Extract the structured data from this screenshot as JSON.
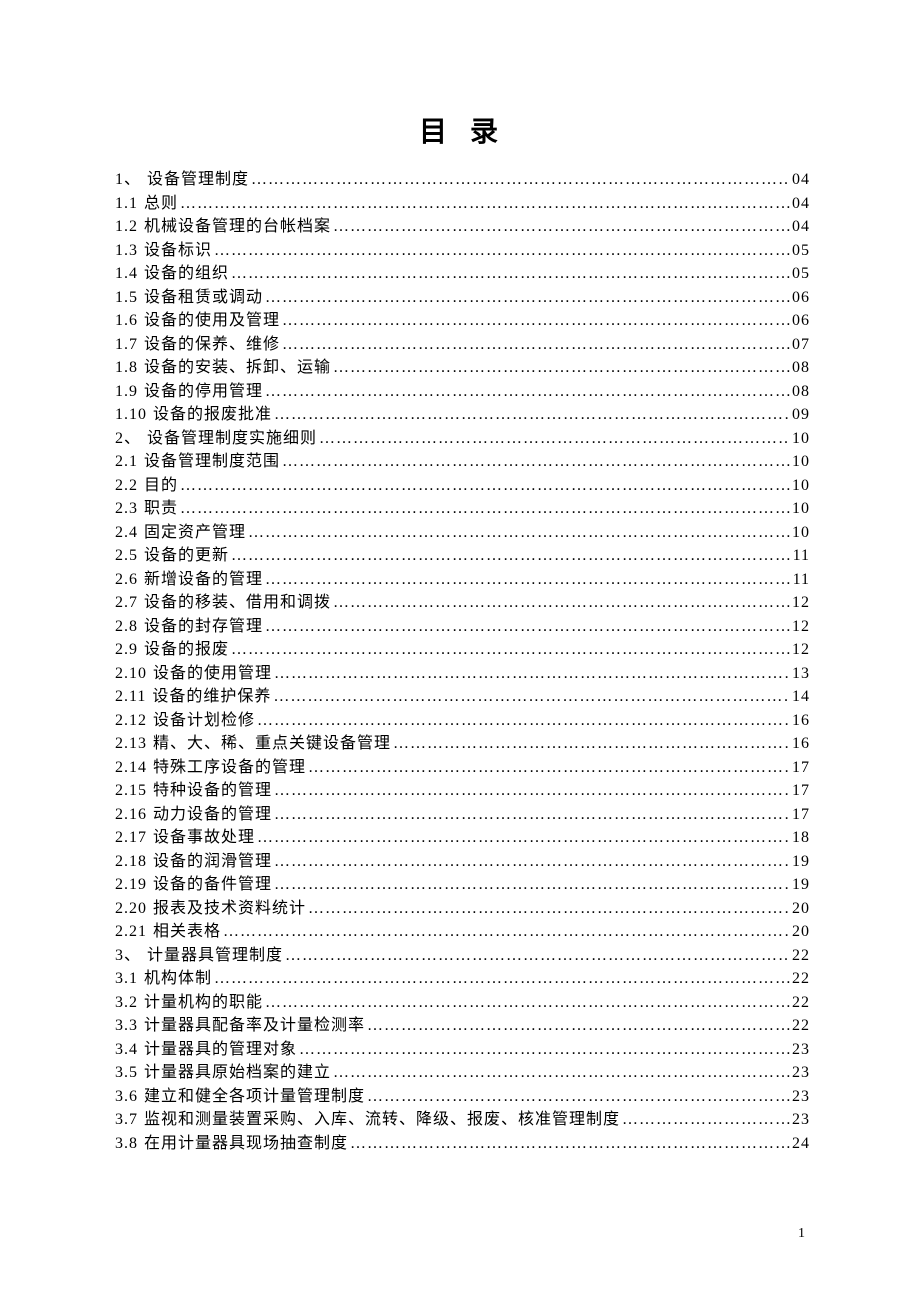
{
  "title": "目 录",
  "page_number": "1",
  "entries": [
    {
      "num": "1、",
      "label": "设备管理制度",
      "page": "04"
    },
    {
      "num": "1.1",
      "label": "总则",
      "page": "04"
    },
    {
      "num": "1.2",
      "label": "机械设备管理的台帐档案",
      "page": "04"
    },
    {
      "num": "1.3",
      "label": "设备标识",
      "page": "05"
    },
    {
      "num": "1.4",
      "label": "设备的组织",
      "page": "05"
    },
    {
      "num": "1.5",
      "label": "设备租赁或调动",
      "page": "06"
    },
    {
      "num": "1.6",
      "label": "设备的使用及管理",
      "page": "06"
    },
    {
      "num": "1.7",
      "label": "设备的保养、维修",
      "page": "07"
    },
    {
      "num": "1.8",
      "label": "设备的安装、拆卸、运输",
      "page": "08"
    },
    {
      "num": "1.9",
      "label": "设备的停用管理",
      "page": "08"
    },
    {
      "num": "1.10",
      "label": "设备的报废批准",
      "page": "09"
    },
    {
      "num": "2、",
      "label": "设备管理制度实施细则",
      "page": "10"
    },
    {
      "num": "2.1",
      "label": "设备管理制度范围",
      "page": "10"
    },
    {
      "num": "2.2",
      "label": "目的",
      "page": "10"
    },
    {
      "num": "2.3",
      "label": "职责",
      "page": "10"
    },
    {
      "num": "2.4",
      "label": "固定资产管理",
      "page": "10"
    },
    {
      "num": "2.5",
      "label": "设备的更新",
      "page": "11"
    },
    {
      "num": "2.6",
      "label": "新增设备的管理",
      "page": "11"
    },
    {
      "num": "2.7",
      "label": "设备的移装、借用和调拨",
      "page": "12"
    },
    {
      "num": "2.8",
      "label": "设备的封存管理",
      "page": "12"
    },
    {
      "num": "2.9",
      "label": "设备的报废",
      "page": "12"
    },
    {
      "num": "2.10",
      "label": "设备的使用管理",
      "page": "13"
    },
    {
      "num": "2.11",
      "label": "设备的维护保养",
      "page": "14"
    },
    {
      "num": "2.12",
      "label": "设备计划检修",
      "page": "16"
    },
    {
      "num": "2.13",
      "label": "精、大、稀、重点关键设备管理",
      "page": "16"
    },
    {
      "num": "2.14",
      "label": "特殊工序设备的管理",
      "page": "17"
    },
    {
      "num": "2.15",
      "label": "特种设备的管理",
      "page": "17"
    },
    {
      "num": "2.16",
      "label": "动力设备的管理",
      "page": "17"
    },
    {
      "num": "2.17",
      "label": "设备事故处理",
      "page": "18"
    },
    {
      "num": "2.18",
      "label": "设备的润滑管理",
      "page": "19"
    },
    {
      "num": "2.19",
      "label": "设备的备件管理",
      "page": "19"
    },
    {
      "num": "2.20",
      "label": "报表及技术资料统计",
      "page": "20"
    },
    {
      "num": "2.21",
      "label": "相关表格",
      "page": "20"
    },
    {
      "num": "3、",
      "label": "计量器具管理制度",
      "page": "22"
    },
    {
      "num": "3.1",
      "label": "机构体制",
      "page": "22"
    },
    {
      "num": "3.2",
      "label": "计量机构的职能",
      "page": "22"
    },
    {
      "num": "3.3",
      "label": "计量器具配备率及计量检测率",
      "page": "22"
    },
    {
      "num": "3.4",
      "label": "计量器具的管理对象",
      "page": "23"
    },
    {
      "num": "3.5",
      "label": "计量器具原始档案的建立",
      "page": "23"
    },
    {
      "num": "3.6",
      "label": "建立和健全各项计量管理制度",
      "page": "23"
    },
    {
      "num": "3.7",
      "label": "监视和测量装置采购、入库、流转、降级、报废、核准管理制度",
      "page": "23"
    },
    {
      "num": "3.8",
      "label": "在用计量器具现场抽查制度",
      "page": "24"
    }
  ]
}
